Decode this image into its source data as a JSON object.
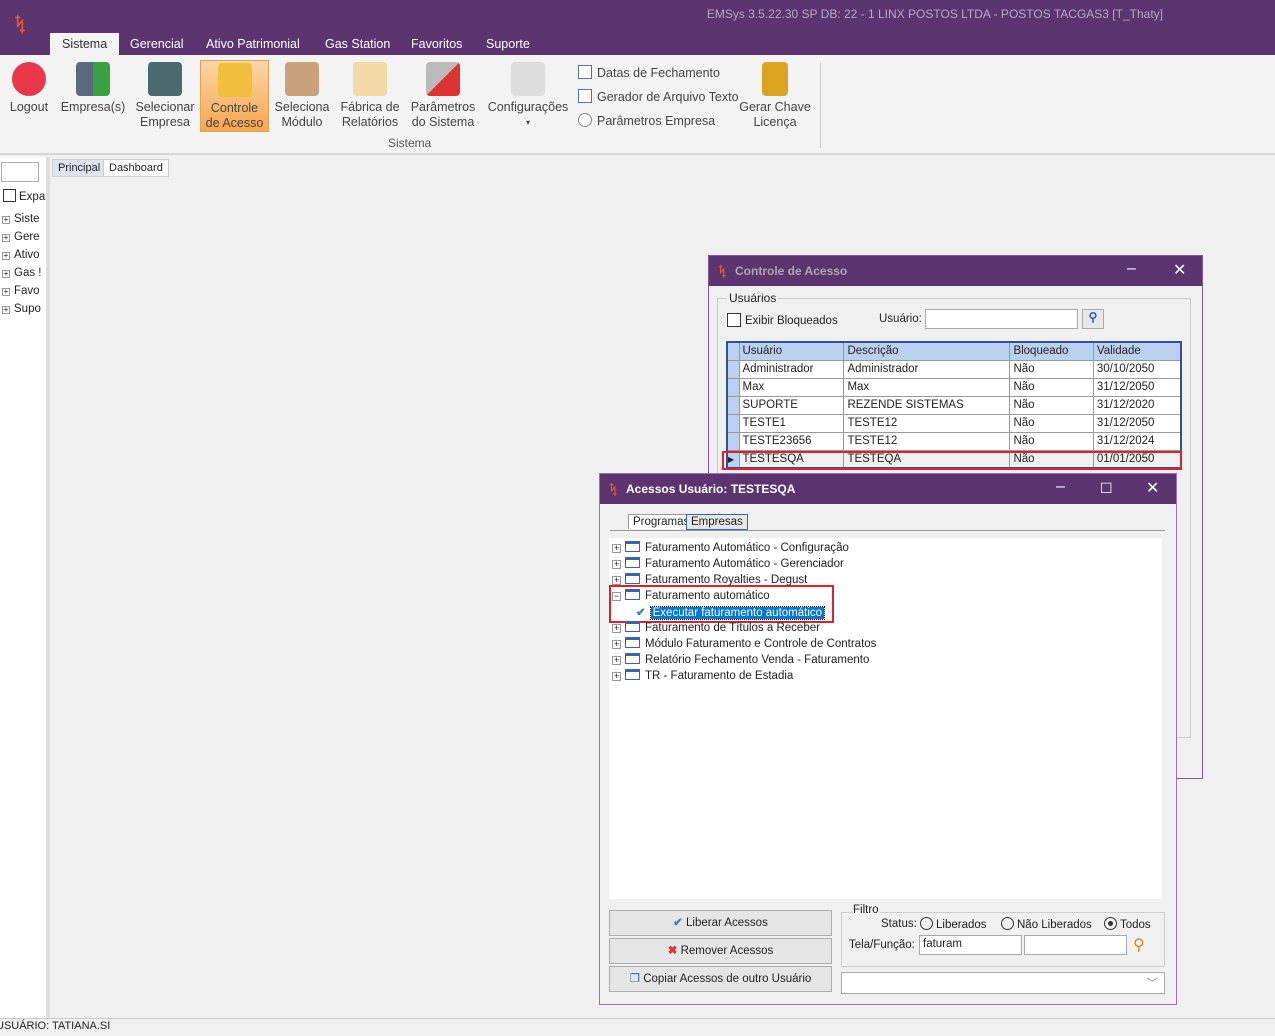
{
  "app": {
    "title": "EMSys 3.5.22.30 SP DB: 22 - 1 LINX POSTOS LTDA - POSTOS TACGAS3 [T_Thaty]",
    "logo": "emsys-logo",
    "accent": "#5b3470"
  },
  "menu_tabs": [
    "Sistema",
    "Gerencial",
    "Ativo Patrimonial",
    "Gas Station",
    "Favoritos",
    "Suporte"
  ],
  "ribbon": {
    "group_label": "Sistema",
    "buttons": [
      {
        "l1": "Logout",
        "l2": "",
        "icon": "power-icon"
      },
      {
        "l1": "Empresa(s)",
        "l2": "",
        "icon": "building-check-icon"
      },
      {
        "l1": "Selecionar",
        "l2": "Empresa",
        "icon": "building-icon"
      },
      {
        "l1": "Controle",
        "l2": "de Acesso",
        "icon": "lock-icon"
      },
      {
        "l1": "Seleciona",
        "l2": "Módulo",
        "icon": "user-module-icon"
      },
      {
        "l1": "Fábrica de",
        "l2": "Relatórios",
        "icon": "report-icon"
      },
      {
        "l1": "Parâmetros",
        "l2": "do Sistema",
        "icon": "tools-icon"
      },
      {
        "l1": "Configurações",
        "l2": "▾",
        "icon": "settings-icon"
      },
      {
        "l1": "Gerar Chave",
        "l2": "Licença",
        "icon": "padlock-icon"
      }
    ],
    "small": [
      "Datas de Fechamento",
      "Gerador de Arquivo Texto",
      "Parâmetros Empresa"
    ]
  },
  "sidebar": {
    "expand_label": "Expa",
    "items": [
      "Siste",
      "Gere",
      "Ativo",
      "Gas !",
      "Favo",
      "Supo"
    ]
  },
  "workspace_tabs": [
    "Principal",
    "Dashboard"
  ],
  "controle": {
    "title": "Controle de Acesso",
    "group": "Usuários",
    "show_blocked": "Exibir Bloqueados",
    "user_label": "Usuário:",
    "user_value": "",
    "columns": [
      "Usuário",
      "Descrição",
      "Bloqueado",
      "Validade"
    ],
    "rows": [
      [
        "Administrador",
        "Administrador",
        "Não",
        "30/10/2050"
      ],
      [
        "Max",
        "Max",
        "Não",
        "31/12/2050"
      ],
      [
        "SUPORTE",
        "REZENDE SISTEMAS",
        "Não",
        "31/12/2020"
      ],
      [
        "TESTE1",
        "TESTE12",
        "Não",
        "31/12/2050"
      ],
      [
        "TESTE23656",
        "TESTE12",
        "Não",
        "31/12/2024"
      ],
      [
        "TESTESQA",
        "TESTEQA",
        "Não",
        "01/01/2050"
      ]
    ]
  },
  "acessos": {
    "title": "Acessos Usuário: TESTESQA",
    "tabs": [
      "Programas",
      "Empresas"
    ],
    "tree": [
      "Faturamento Automático - Configuração",
      "Faturamento Automático - Gerenciador",
      "Faturamento Royalties - Degust",
      "Faturamento automático",
      "Executar faturamento automático",
      "Faturamento de Títulos a Receber",
      "Módulo Faturamento e Controle de Contratos",
      "Relatório Fechamento Venda - Faturamento",
      "TR - Faturamento de Estadia"
    ],
    "buttons": [
      "Liberar Acessos",
      "Remover Acessos",
      "Copiar Acessos de outro Usuário"
    ],
    "filter": {
      "label": "Filtro",
      "status_label": "Status:",
      "options": [
        "Liberados",
        "Não Liberados",
        "Todos"
      ],
      "selected": "Todos",
      "tela_label": "Tela/Função:",
      "tela_value": "faturam",
      "tela_value2": ""
    },
    "combo_value": ""
  },
  "status_bar": "USUÁRIO: TATIANA.SI"
}
